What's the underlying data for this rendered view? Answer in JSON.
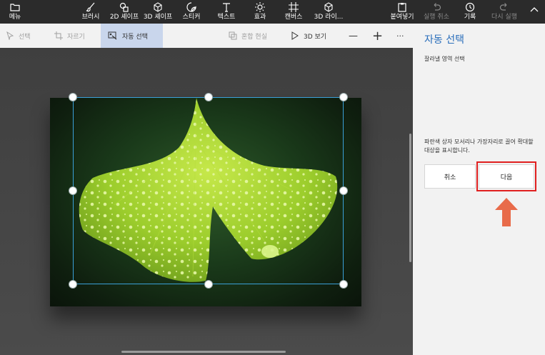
{
  "topbar": {
    "menu": "메뉴",
    "tools": [
      "브러시",
      "2D 셰이프",
      "3D 셰이프",
      "스티커",
      "텍스트",
      "효과",
      "캔버스",
      "3D 라이..."
    ],
    "paste": "붙여넣기",
    "undo": "실행 취소",
    "history": "기록",
    "redo": "다시 실행"
  },
  "toolbar": {
    "select": "선택",
    "crop": "자르기",
    "magic_select": "자동 선택",
    "mixed_reality": "혼합 현실",
    "view_3d": "3D 보기",
    "zoom_out": "—",
    "zoom_in": "+",
    "more": "···"
  },
  "panel": {
    "title": "자동 선택",
    "subtitle": "잘라낼 영역 선택",
    "instructions": "파란색 상자 모서리나 가장자리로 끌어 확대할 대상을 표시합니다.",
    "cancel": "취소",
    "next": "다음"
  },
  "colors": {
    "topbar": "#2b2b2b",
    "toolbar": "#f2f2f2",
    "selected_tool": "#c9d6ec",
    "title": "#2a6ebb",
    "highlight": "#e02020",
    "arrow": "#e86b4a",
    "selection_border": "#3aa0d8"
  }
}
